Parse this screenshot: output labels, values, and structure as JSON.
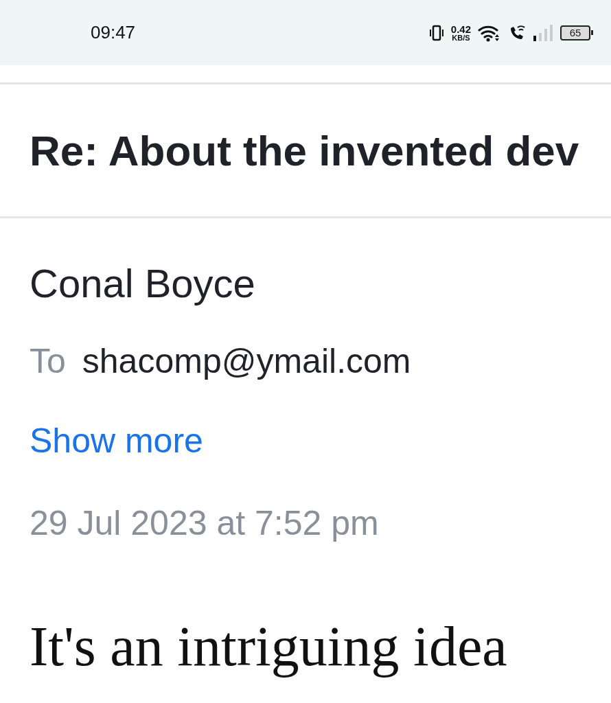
{
  "status_bar": {
    "time": "09:47",
    "speed_value": "0.42",
    "speed_unit": "KB/S",
    "battery": "65"
  },
  "message": {
    "subject": "Re: About the invented dev",
    "sender": "Conal Boyce",
    "to_label": "To",
    "to_address": "shacomp@ymail.com",
    "show_more": "Show more",
    "date": "29 Jul 2023 at 7:52 pm",
    "body": "It's an intriguing idea"
  }
}
